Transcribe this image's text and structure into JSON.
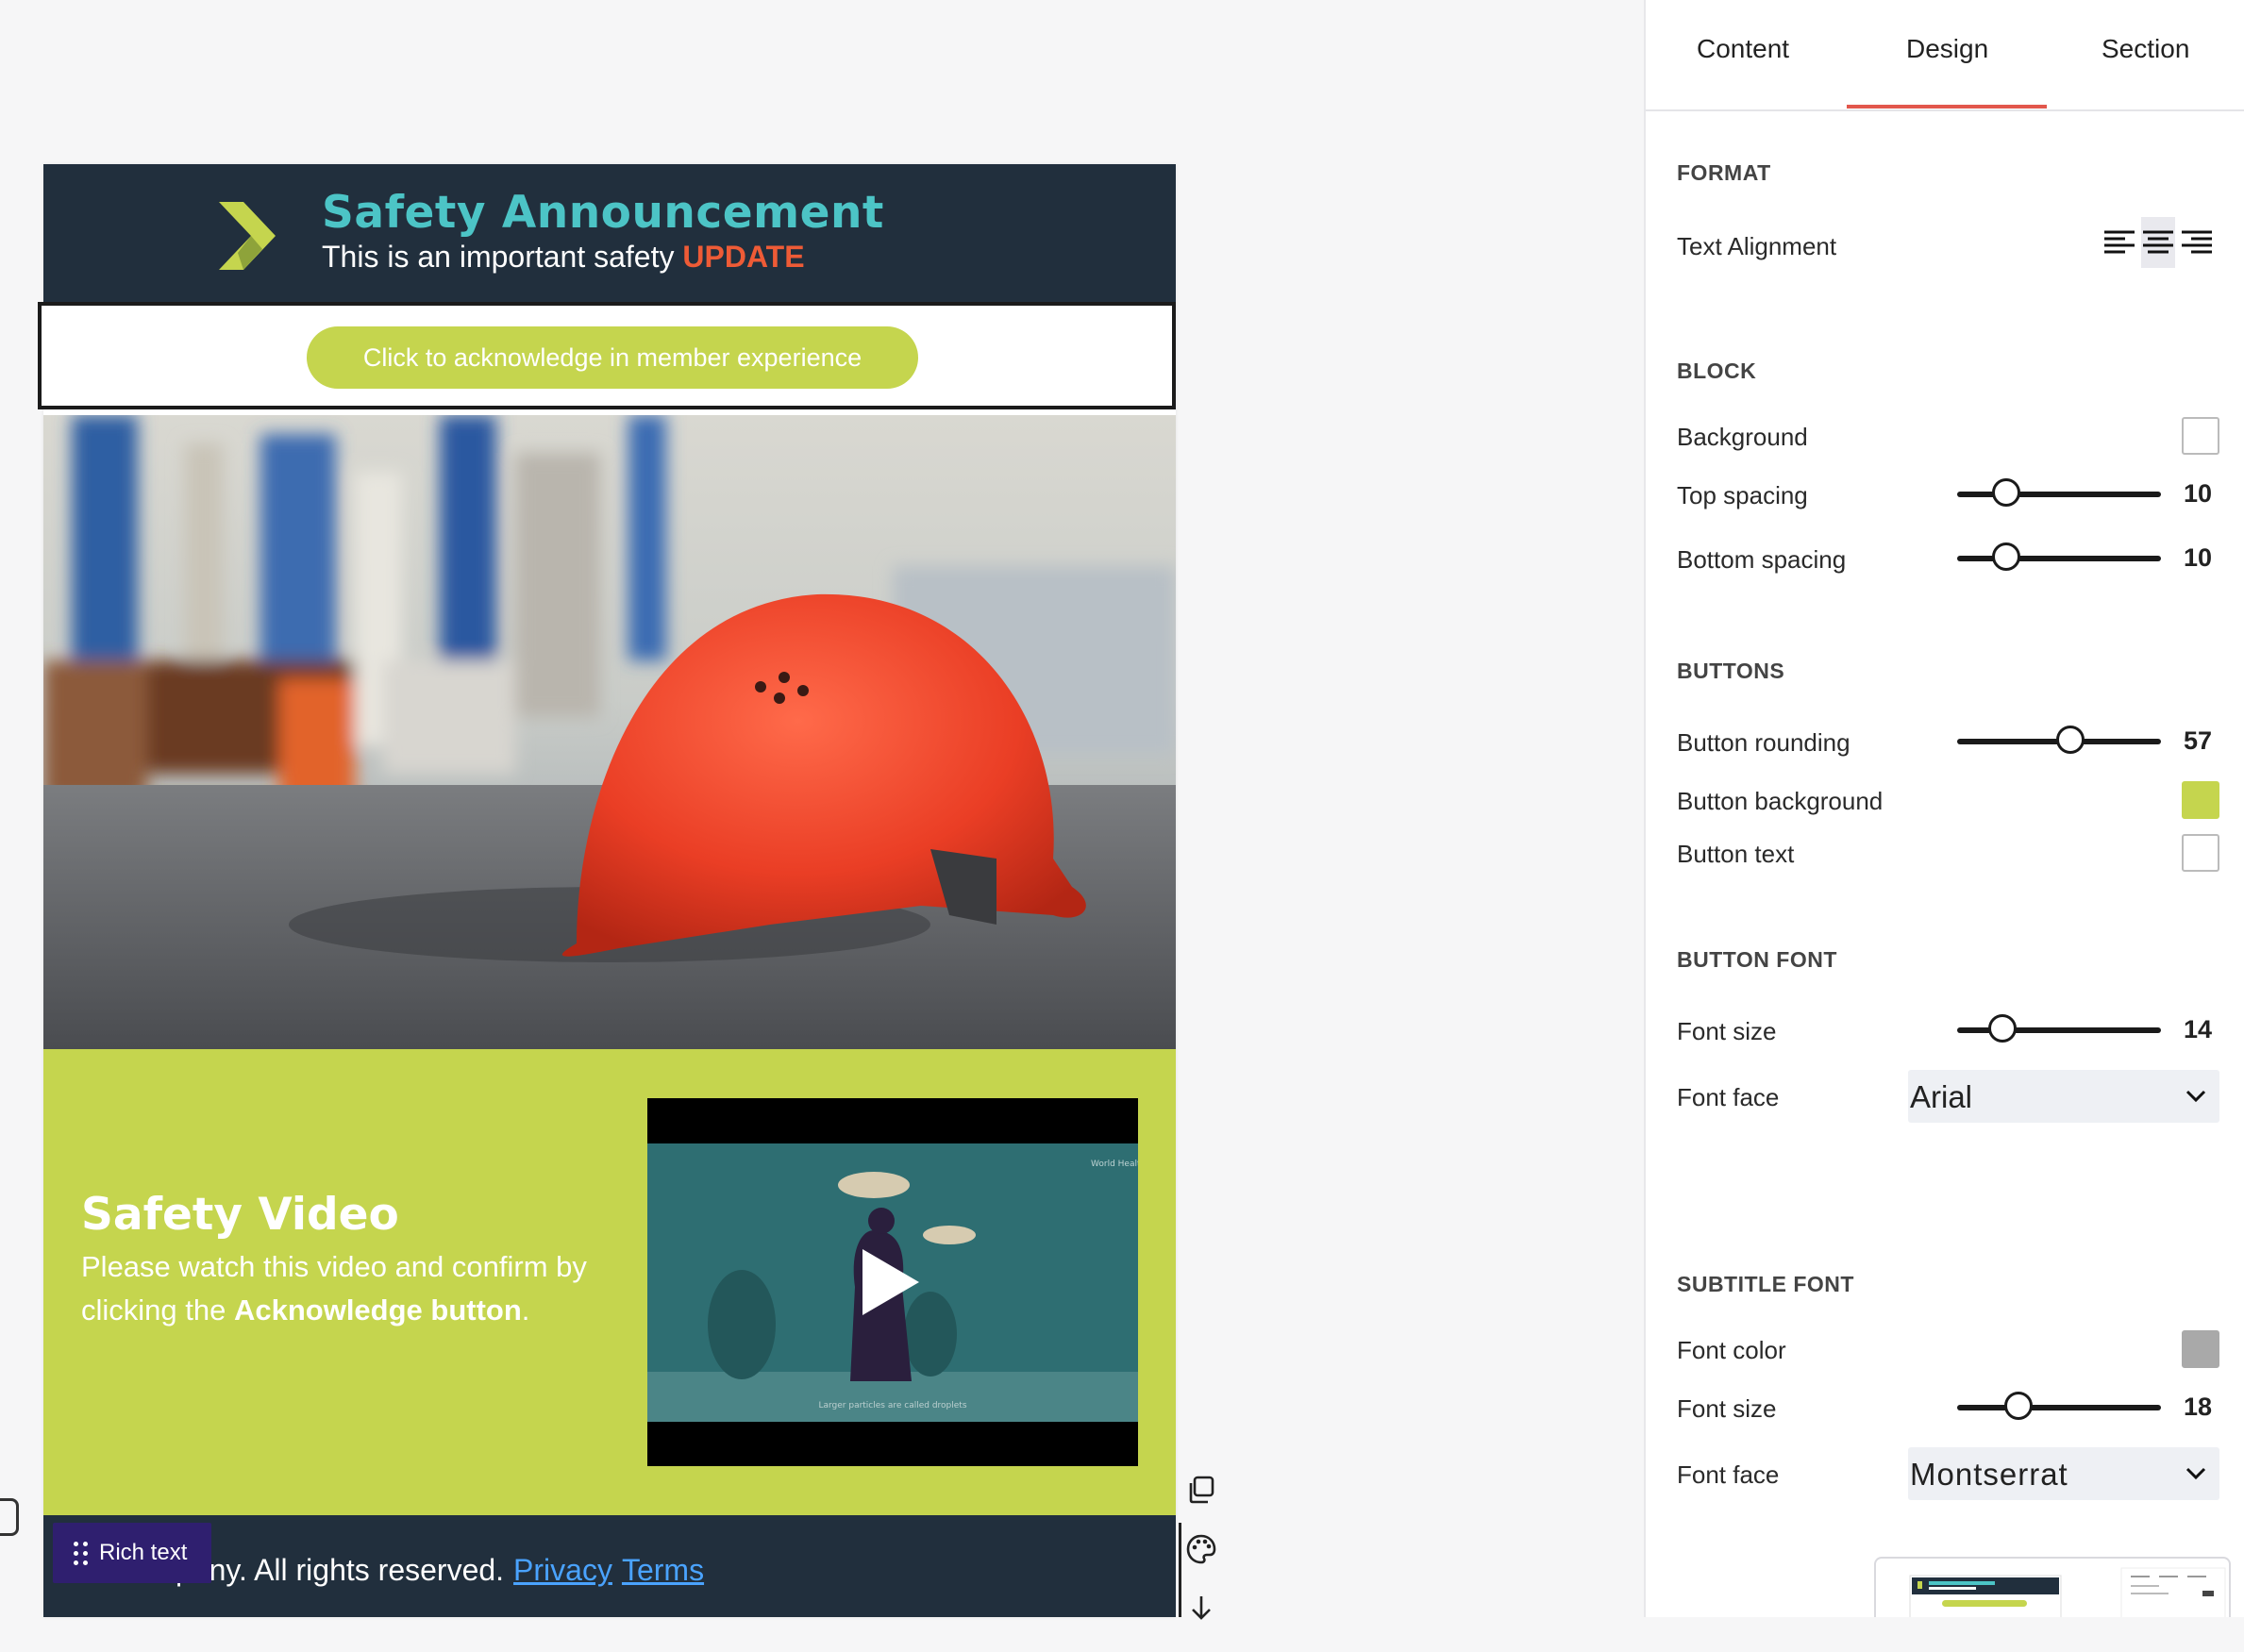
{
  "email": {
    "header_title": "Safety Announcement",
    "header_sub_prefix": "This is an important safety ",
    "header_sub_highlight": "UPDATE",
    "ack_button": "Click to acknowledge in member experience",
    "video_title": "Safety Video",
    "video_text_prefix": "Please watch this video and confirm by clicking the ",
    "video_text_bold": "Acknowledge button",
    "video_text_suffix": ".",
    "video_watermark": "World Health Organization",
    "video_caption": "Larger particles are called droplets",
    "footer_text": "© Company. All rights reserved.",
    "footer_link_privacy": "Privacy",
    "footer_link_terms": "Terms"
  },
  "canvas": {
    "rich_text_chip": "Rich text"
  },
  "panel": {
    "tabs": [
      "Content",
      "Design",
      "Section"
    ],
    "active_tab": "Design",
    "format": {
      "heading": "FORMAT",
      "text_alignment_label": "Text Alignment",
      "selected_alignment": "center"
    },
    "block": {
      "heading": "BLOCK",
      "background_label": "Background",
      "background_color": "#ffffff",
      "top_spacing_label": "Top spacing",
      "top_spacing_value": "10",
      "bottom_spacing_label": "Bottom spacing",
      "bottom_spacing_value": "10"
    },
    "buttons": {
      "heading": "BUTTONS",
      "rounding_label": "Button rounding",
      "rounding_value": "57",
      "background_label": "Button background",
      "background_color": "#c5d54e",
      "text_label": "Button text",
      "text_color": "#ffffff"
    },
    "button_font": {
      "heading": "BUTTON FONT",
      "size_label": "Font size",
      "size_value": "14",
      "face_label": "Font face",
      "face_value": "Arial"
    },
    "subtitle_font": {
      "heading": "SUBTITLE FONT",
      "color_label": "Font color",
      "color_value": "#a9a9a9",
      "size_label": "Font size",
      "size_value": "18",
      "face_label": "Font face",
      "face_value": "Montserrat"
    }
  },
  "colors": {
    "header_bg": "#212f3d",
    "accent_teal": "#4cc4c6",
    "accent_lime": "#c5d54e",
    "update_red": "#ee5b36",
    "tab_underline": "#e2574c"
  }
}
